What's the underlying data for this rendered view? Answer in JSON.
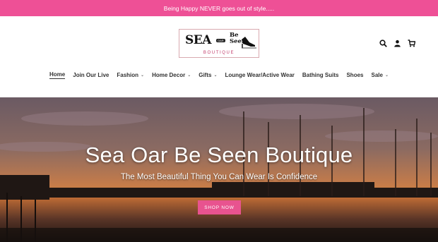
{
  "announcement": "Being Happy NEVER goes out of style.....",
  "logo": {
    "word_sea": "SEA",
    "word_oar": "OAR",
    "word_be_seen": "Be Seen",
    "word_boutique": "BOUTIQUE"
  },
  "nav": {
    "items": [
      {
        "label": "Home",
        "active": true,
        "dropdown": false
      },
      {
        "label": "Join Our Live",
        "dropdown": false
      },
      {
        "label": "Fashion",
        "dropdown": true
      },
      {
        "label": "Home Decor",
        "dropdown": true
      },
      {
        "label": "Gifts",
        "dropdown": true
      },
      {
        "label": "Lounge Wear/Active Wear",
        "dropdown": false
      },
      {
        "label": "Bathing Suits",
        "dropdown": false
      },
      {
        "label": "Shoes",
        "dropdown": false
      },
      {
        "label": "Sale",
        "dropdown": true
      }
    ]
  },
  "icons": {
    "search": "search-icon",
    "account": "user-icon",
    "cart": "cart-icon"
  },
  "hero": {
    "title": "Sea Oar Be Seen Boutique",
    "subtitle": "The Most Beautiful Thing You Can Wear Is Confidence",
    "button": "SHOP NOW"
  },
  "colors": {
    "announcement_bg": "#ee5096",
    "button_bg": "#e8538f"
  }
}
